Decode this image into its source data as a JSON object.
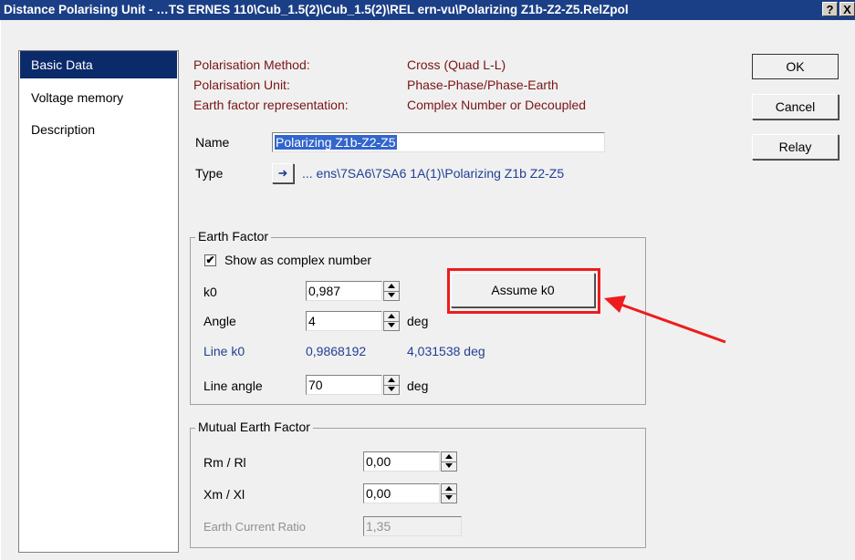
{
  "window": {
    "title": "Distance Polarising Unit - …TS ERNES 110\\Cub_1.5(2)\\Cub_1.5(2)\\REL ern-vu\\Polarizing Z1b-Z2-Z5.RelZpol",
    "help_btn": "?",
    "close_btn": "X"
  },
  "sidebar": {
    "items": [
      {
        "label": "Basic Data"
      },
      {
        "label": "Voltage memory"
      },
      {
        "label": "Description"
      }
    ]
  },
  "info": {
    "method_label": "Polarisation Method:",
    "method_value": "Cross (Quad L-L)",
    "unit_label": "Polarisation Unit:",
    "unit_value": "Phase-Phase/Phase-Earth",
    "earth_label": "Earth factor representation:",
    "earth_value": "Complex Number or Decoupled"
  },
  "name": {
    "label": "Name",
    "value": "Polarizing Z1b-Z2-Z5"
  },
  "type": {
    "label": "Type",
    "value": "... ens\\7SA6\\7SA6 1A(1)\\Polarizing Z1b Z2-Z5",
    "jump_glyph": "➜"
  },
  "earth_factor": {
    "title": "Earth Factor",
    "show_complex_label": "Show as complex number",
    "show_complex_checked": "✔",
    "k0_label": "k0",
    "k0_value": "0,987",
    "angle_label": "Angle",
    "angle_value": "4",
    "angle_unit": "deg",
    "line_k0_label": "Line k0",
    "line_k0_value": "0,9868192",
    "line_k0_angle": "4,031538 deg",
    "line_angle_label": "Line angle",
    "line_angle_value": "70",
    "line_angle_unit": "deg",
    "assume_btn": "Assume k0"
  },
  "mutual": {
    "title": "Mutual Earth Factor",
    "rm_label": "Rm / Rl",
    "rm_value": "0,00",
    "xm_label": "Xm / Xl",
    "xm_value": "0,00",
    "ratio_label": "Earth Current Ratio",
    "ratio_value": "1,35"
  },
  "buttons": {
    "ok": "OK",
    "cancel": "Cancel",
    "relay": "Relay"
  },
  "colors": {
    "annotation": "#ee1c1c",
    "title_bar": "#1b3f86",
    "selection": "#0b2a6a"
  }
}
